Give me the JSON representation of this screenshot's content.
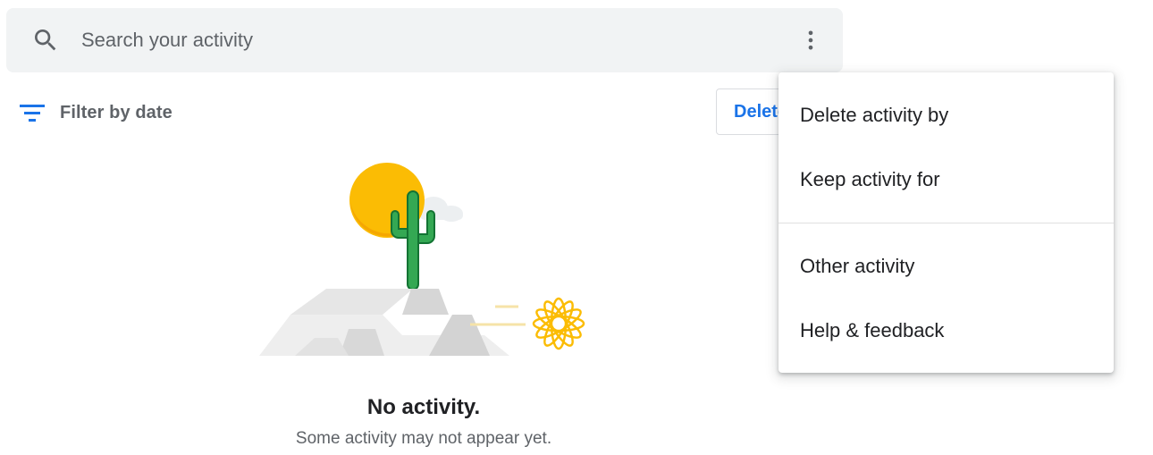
{
  "search": {
    "placeholder": "Search your activity",
    "value": "",
    "icon": "search-icon",
    "more_icon": "more-vert-icon"
  },
  "filter": {
    "label": "Filter by date",
    "icon": "filter-list-icon",
    "icon_color": "#1a73e8"
  },
  "delete_button": {
    "label": "Delete"
  },
  "empty_state": {
    "title": "No activity.",
    "subtitle": "Some activity may not appear yet."
  },
  "menu": {
    "items": [
      {
        "label": "Delete activity by"
      },
      {
        "label": "Keep activity for"
      },
      {
        "label": "Other activity"
      },
      {
        "label": "Help & feedback"
      }
    ]
  },
  "colors": {
    "accent": "#1a73e8",
    "search_bg": "#f1f3f4",
    "sun": "#fbbc04",
    "cactus": "#34a853"
  }
}
